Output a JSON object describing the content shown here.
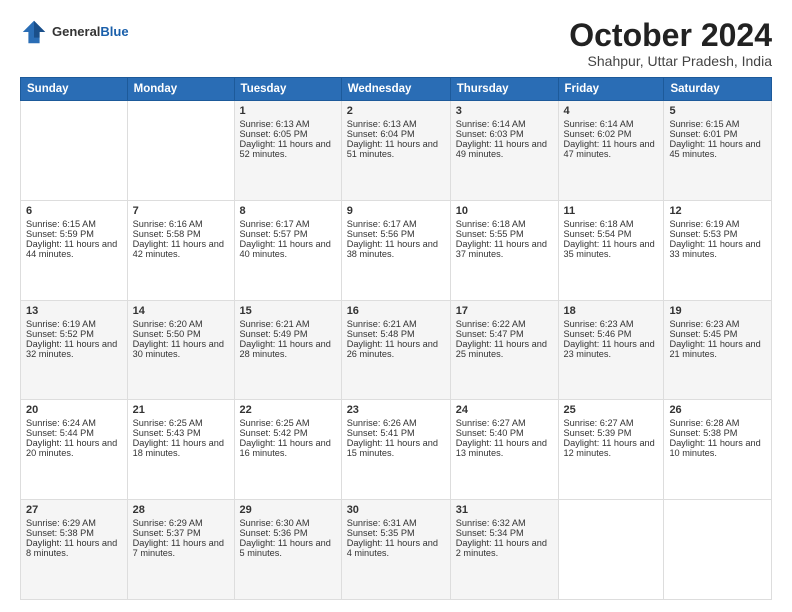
{
  "header": {
    "logo_general": "General",
    "logo_blue": "Blue",
    "month_title": "October 2024",
    "location": "Shahpur, Uttar Pradesh, India"
  },
  "weekdays": [
    "Sunday",
    "Monday",
    "Tuesday",
    "Wednesday",
    "Thursday",
    "Friday",
    "Saturday"
  ],
  "weeks": [
    [
      {
        "day": "",
        "sunrise": "",
        "sunset": "",
        "daylight": ""
      },
      {
        "day": "",
        "sunrise": "",
        "sunset": "",
        "daylight": ""
      },
      {
        "day": "1",
        "sunrise": "Sunrise: 6:13 AM",
        "sunset": "Sunset: 6:05 PM",
        "daylight": "Daylight: 11 hours and 52 minutes."
      },
      {
        "day": "2",
        "sunrise": "Sunrise: 6:13 AM",
        "sunset": "Sunset: 6:04 PM",
        "daylight": "Daylight: 11 hours and 51 minutes."
      },
      {
        "day": "3",
        "sunrise": "Sunrise: 6:14 AM",
        "sunset": "Sunset: 6:03 PM",
        "daylight": "Daylight: 11 hours and 49 minutes."
      },
      {
        "day": "4",
        "sunrise": "Sunrise: 6:14 AM",
        "sunset": "Sunset: 6:02 PM",
        "daylight": "Daylight: 11 hours and 47 minutes."
      },
      {
        "day": "5",
        "sunrise": "Sunrise: 6:15 AM",
        "sunset": "Sunset: 6:01 PM",
        "daylight": "Daylight: 11 hours and 45 minutes."
      }
    ],
    [
      {
        "day": "6",
        "sunrise": "Sunrise: 6:15 AM",
        "sunset": "Sunset: 5:59 PM",
        "daylight": "Daylight: 11 hours and 44 minutes."
      },
      {
        "day": "7",
        "sunrise": "Sunrise: 6:16 AM",
        "sunset": "Sunset: 5:58 PM",
        "daylight": "Daylight: 11 hours and 42 minutes."
      },
      {
        "day": "8",
        "sunrise": "Sunrise: 6:17 AM",
        "sunset": "Sunset: 5:57 PM",
        "daylight": "Daylight: 11 hours and 40 minutes."
      },
      {
        "day": "9",
        "sunrise": "Sunrise: 6:17 AM",
        "sunset": "Sunset: 5:56 PM",
        "daylight": "Daylight: 11 hours and 38 minutes."
      },
      {
        "day": "10",
        "sunrise": "Sunrise: 6:18 AM",
        "sunset": "Sunset: 5:55 PM",
        "daylight": "Daylight: 11 hours and 37 minutes."
      },
      {
        "day": "11",
        "sunrise": "Sunrise: 6:18 AM",
        "sunset": "Sunset: 5:54 PM",
        "daylight": "Daylight: 11 hours and 35 minutes."
      },
      {
        "day": "12",
        "sunrise": "Sunrise: 6:19 AM",
        "sunset": "Sunset: 5:53 PM",
        "daylight": "Daylight: 11 hours and 33 minutes."
      }
    ],
    [
      {
        "day": "13",
        "sunrise": "Sunrise: 6:19 AM",
        "sunset": "Sunset: 5:52 PM",
        "daylight": "Daylight: 11 hours and 32 minutes."
      },
      {
        "day": "14",
        "sunrise": "Sunrise: 6:20 AM",
        "sunset": "Sunset: 5:50 PM",
        "daylight": "Daylight: 11 hours and 30 minutes."
      },
      {
        "day": "15",
        "sunrise": "Sunrise: 6:21 AM",
        "sunset": "Sunset: 5:49 PM",
        "daylight": "Daylight: 11 hours and 28 minutes."
      },
      {
        "day": "16",
        "sunrise": "Sunrise: 6:21 AM",
        "sunset": "Sunset: 5:48 PM",
        "daylight": "Daylight: 11 hours and 26 minutes."
      },
      {
        "day": "17",
        "sunrise": "Sunrise: 6:22 AM",
        "sunset": "Sunset: 5:47 PM",
        "daylight": "Daylight: 11 hours and 25 minutes."
      },
      {
        "day": "18",
        "sunrise": "Sunrise: 6:23 AM",
        "sunset": "Sunset: 5:46 PM",
        "daylight": "Daylight: 11 hours and 23 minutes."
      },
      {
        "day": "19",
        "sunrise": "Sunrise: 6:23 AM",
        "sunset": "Sunset: 5:45 PM",
        "daylight": "Daylight: 11 hours and 21 minutes."
      }
    ],
    [
      {
        "day": "20",
        "sunrise": "Sunrise: 6:24 AM",
        "sunset": "Sunset: 5:44 PM",
        "daylight": "Daylight: 11 hours and 20 minutes."
      },
      {
        "day": "21",
        "sunrise": "Sunrise: 6:25 AM",
        "sunset": "Sunset: 5:43 PM",
        "daylight": "Daylight: 11 hours and 18 minutes."
      },
      {
        "day": "22",
        "sunrise": "Sunrise: 6:25 AM",
        "sunset": "Sunset: 5:42 PM",
        "daylight": "Daylight: 11 hours and 16 minutes."
      },
      {
        "day": "23",
        "sunrise": "Sunrise: 6:26 AM",
        "sunset": "Sunset: 5:41 PM",
        "daylight": "Daylight: 11 hours and 15 minutes."
      },
      {
        "day": "24",
        "sunrise": "Sunrise: 6:27 AM",
        "sunset": "Sunset: 5:40 PM",
        "daylight": "Daylight: 11 hours and 13 minutes."
      },
      {
        "day": "25",
        "sunrise": "Sunrise: 6:27 AM",
        "sunset": "Sunset: 5:39 PM",
        "daylight": "Daylight: 11 hours and 12 minutes."
      },
      {
        "day": "26",
        "sunrise": "Sunrise: 6:28 AM",
        "sunset": "Sunset: 5:38 PM",
        "daylight": "Daylight: 11 hours and 10 minutes."
      }
    ],
    [
      {
        "day": "27",
        "sunrise": "Sunrise: 6:29 AM",
        "sunset": "Sunset: 5:38 PM",
        "daylight": "Daylight: 11 hours and 8 minutes."
      },
      {
        "day": "28",
        "sunrise": "Sunrise: 6:29 AM",
        "sunset": "Sunset: 5:37 PM",
        "daylight": "Daylight: 11 hours and 7 minutes."
      },
      {
        "day": "29",
        "sunrise": "Sunrise: 6:30 AM",
        "sunset": "Sunset: 5:36 PM",
        "daylight": "Daylight: 11 hours and 5 minutes."
      },
      {
        "day": "30",
        "sunrise": "Sunrise: 6:31 AM",
        "sunset": "Sunset: 5:35 PM",
        "daylight": "Daylight: 11 hours and 4 minutes."
      },
      {
        "day": "31",
        "sunrise": "Sunrise: 6:32 AM",
        "sunset": "Sunset: 5:34 PM",
        "daylight": "Daylight: 11 hours and 2 minutes."
      },
      {
        "day": "",
        "sunrise": "",
        "sunset": "",
        "daylight": ""
      },
      {
        "day": "",
        "sunrise": "",
        "sunset": "",
        "daylight": ""
      }
    ]
  ]
}
